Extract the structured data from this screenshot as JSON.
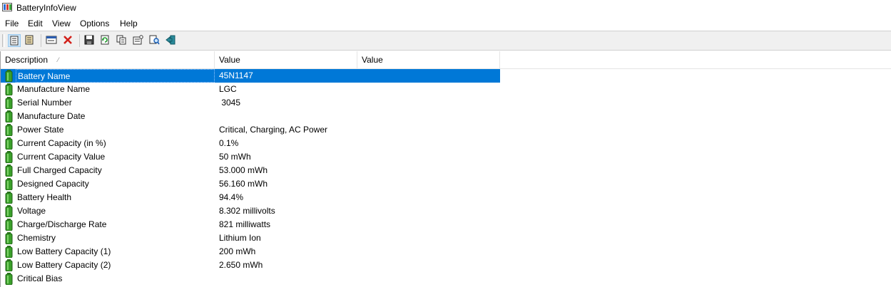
{
  "window": {
    "title": "BatteryInfoView"
  },
  "menu": [
    "File",
    "Edit",
    "View",
    "Options",
    "Help"
  ],
  "toolbar": {
    "buttons": [
      "html-report-all-icon",
      "html-report-selected-icon",
      "properties-window-icon",
      "delete-icon",
      "save-icon",
      "refresh-icon",
      "copy-icon",
      "options-icon",
      "find-icon",
      "exit-icon"
    ]
  },
  "columns": [
    "Description",
    "Value",
    "Value"
  ],
  "rows": [
    {
      "description": "Battery Name",
      "value": "45N1147",
      "value2": ""
    },
    {
      "description": "Manufacture Name",
      "value": "LGC",
      "value2": ""
    },
    {
      "description": "Serial Number",
      "value": " 3045",
      "value2": ""
    },
    {
      "description": "Manufacture Date",
      "value": "",
      "value2": ""
    },
    {
      "description": "Power State",
      "value": "Critical, Charging, AC Power",
      "value2": ""
    },
    {
      "description": "Current Capacity (in %)",
      "value": "0.1%",
      "value2": ""
    },
    {
      "description": "Current Capacity Value",
      "value": "50 mWh",
      "value2": ""
    },
    {
      "description": "Full Charged Capacity",
      "value": "53.000 mWh",
      "value2": ""
    },
    {
      "description": "Designed Capacity",
      "value": "56.160 mWh",
      "value2": ""
    },
    {
      "description": "Battery Health",
      "value": "94.4%",
      "value2": ""
    },
    {
      "description": "Voltage",
      "value": "8.302 millivolts",
      "value2": ""
    },
    {
      "description": "Charge/Discharge Rate",
      "value": "821 milliwatts",
      "value2": ""
    },
    {
      "description": "Chemistry",
      "value": "Lithium Ion",
      "value2": ""
    },
    {
      "description": "Low Battery Capacity (1)",
      "value": "200 mWh",
      "value2": ""
    },
    {
      "description": "Low Battery Capacity (2)",
      "value": "2.650 mWh",
      "value2": ""
    },
    {
      "description": "Critical Bias",
      "value": "",
      "value2": ""
    }
  ],
  "selected_row": 0,
  "colors": {
    "selection": "#0078d7",
    "battery_green": "#3aa02a"
  }
}
